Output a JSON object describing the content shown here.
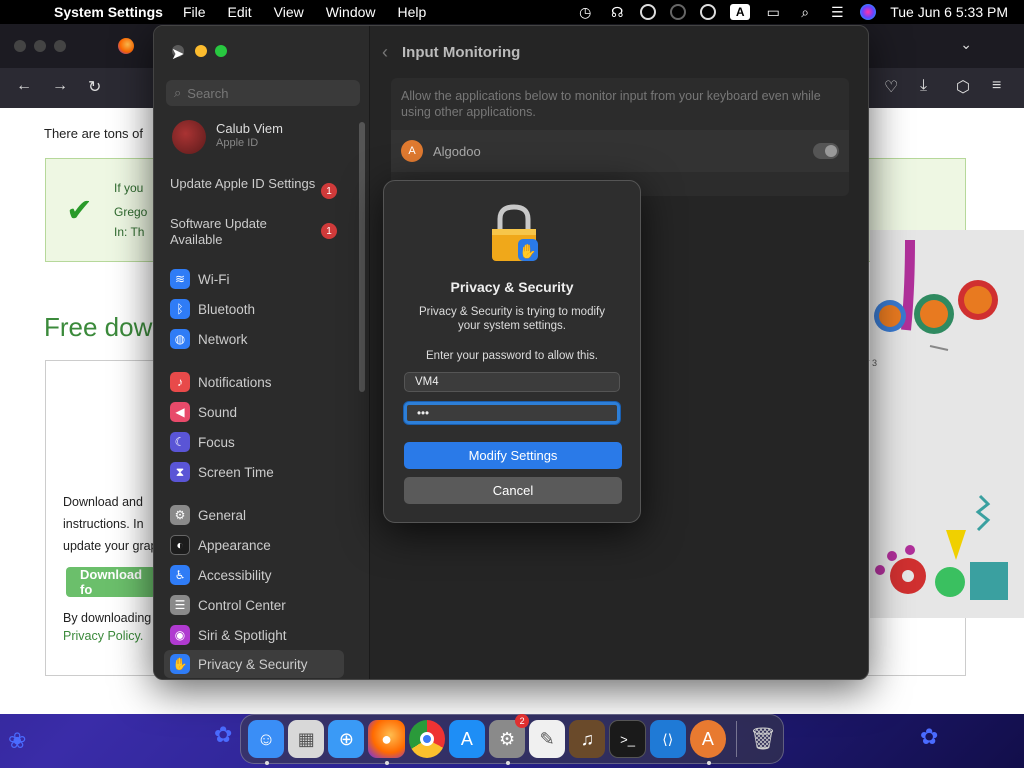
{
  "menubar": {
    "app": "System Settings",
    "items": [
      "File",
      "Edit",
      "View",
      "Window",
      "Help"
    ],
    "clock": "Tue Jun 6  5:33 PM",
    "input_source": "A",
    "status_icons": [
      "time-machine-icon",
      "hearing-icon",
      "accessibility-icon",
      "vpn-icon",
      "user-icon",
      "keyboard-icon",
      "screen-mirror-icon",
      "spotlight-icon",
      "control-center-icon",
      "siri-icon"
    ]
  },
  "browser": {
    "intro": "There are tons of",
    "notice": {
      "line1": "If you",
      "line2": "Grego",
      "line3": "In: Th"
    },
    "heading": "Free dow",
    "download_text": [
      "Download and",
      "instructions. In",
      "update your grap"
    ],
    "download_button": "Download fo",
    "by_downloading": "By downloading",
    "privacy_link": "Privacy Policy.",
    "algodoo_number": "3"
  },
  "sidebar": {
    "search_placeholder": "Search",
    "account": {
      "name": "Calub Viem",
      "sub": "Apple ID"
    },
    "updates": [
      {
        "label": "Update Apple ID Settings",
        "badge": "1"
      },
      {
        "label": "Software Update Available",
        "badge": "1"
      }
    ],
    "items": [
      {
        "label": "Wi-Fi",
        "icon": "wifi-icon",
        "color": "#2f7cf6"
      },
      {
        "label": "Bluetooth",
        "icon": "bluetooth-icon",
        "color": "#2f7cf6"
      },
      {
        "label": "Network",
        "icon": "globe-icon",
        "color": "#2f7cf6"
      },
      {
        "label": "Notifications",
        "icon": "bell-icon",
        "color": "#e84a4a"
      },
      {
        "label": "Sound",
        "icon": "speaker-icon",
        "color": "#e84a6a"
      },
      {
        "label": "Focus",
        "icon": "moon-icon",
        "color": "#5a55d6"
      },
      {
        "label": "Screen Time",
        "icon": "hourglass-icon",
        "color": "#5a55d6"
      },
      {
        "label": "General",
        "icon": "gear-icon",
        "color": "#8a8a8a"
      },
      {
        "label": "Appearance",
        "icon": "appearance-icon",
        "color": "#1c1c1c"
      },
      {
        "label": "Accessibility",
        "icon": "accessibility-icon",
        "color": "#2f7cf6"
      },
      {
        "label": "Control Center",
        "icon": "control-center-icon",
        "color": "#8a8a8a"
      },
      {
        "label": "Siri & Spotlight",
        "icon": "siri-icon",
        "color": "#b03ad0"
      },
      {
        "label": "Privacy & Security",
        "icon": "hand-icon",
        "color": "#2f7cf6"
      }
    ]
  },
  "pane": {
    "title": "Input Monitoring",
    "description": "Allow the applications below to monitor input from your keyboard even while using other applications.",
    "app_name": "Algodoo"
  },
  "dialog": {
    "title": "Privacy & Security",
    "message": "Privacy & Security is trying to modify your system settings.",
    "prompt": "Enter your password to allow this.",
    "username": "VM4",
    "password_mask": "•••",
    "primary_button": "Modify Settings",
    "secondary_button": "Cancel"
  },
  "dock": {
    "apps": [
      {
        "name": "finder-icon",
        "color": "#3a8ef6",
        "glyph": "☺",
        "running": true
      },
      {
        "name": "launchpad-icon",
        "color": "#d8d8d8",
        "glyph": "▦",
        "running": false
      },
      {
        "name": "safari-icon",
        "color": "#3a9af6",
        "glyph": "⊕",
        "running": false
      },
      {
        "name": "firefox-icon",
        "color": "#ff7a1a",
        "glyph": "●",
        "running": true
      },
      {
        "name": "chrome-icon",
        "color": "#e8e8e8",
        "glyph": "◉",
        "running": false
      },
      {
        "name": "app-store-icon",
        "color": "#1e8ef6",
        "glyph": "A",
        "running": false
      },
      {
        "name": "system-settings-icon",
        "color": "#8a8a8a",
        "glyph": "⚙",
        "running": true,
        "badge": "2"
      },
      {
        "name": "textedit-icon",
        "color": "#f0f0f0",
        "glyph": "✎",
        "running": false
      },
      {
        "name": "garageband-icon",
        "color": "#6a4a2a",
        "glyph": "♫",
        "running": false
      },
      {
        "name": "terminal-icon",
        "color": "#1a1a1a",
        "glyph": ">_",
        "running": false
      },
      {
        "name": "vscode-icon",
        "color": "#1f7ad6",
        "glyph": "⟨⟩",
        "running": false
      },
      {
        "name": "algodoo-icon",
        "color": "#e87a30",
        "glyph": "A",
        "running": true
      }
    ],
    "trash": {
      "name": "trash-icon",
      "color": "#9aa",
      "glyph": "🗑"
    }
  }
}
